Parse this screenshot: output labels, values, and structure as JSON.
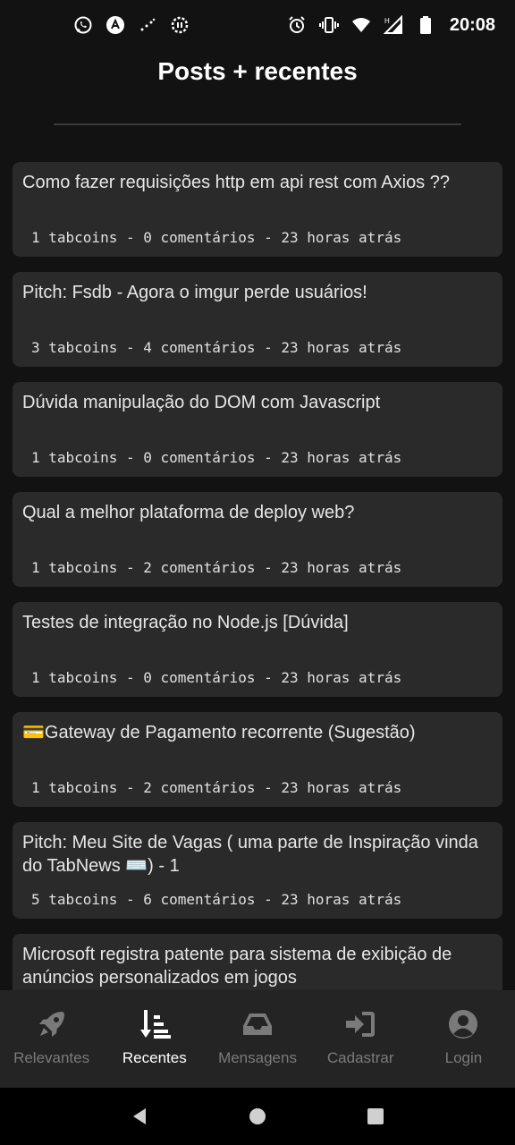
{
  "status_bar": {
    "time": "20:08",
    "left_icons": [
      "whatsapp-icon",
      "app-icon",
      "signal-dots-icon",
      "notification-icon"
    ],
    "right_icons": [
      "alarm-icon",
      "vibrate-icon",
      "wifi-icon",
      "cell-signal-icon",
      "battery-icon"
    ]
  },
  "header": {
    "title": "Posts + recentes"
  },
  "posts": [
    {
      "title": "Como fazer requisições http em api rest com Axios ??",
      "meta": "1 tabcoins - 0 comentários - 23 horas atrás"
    },
    {
      "title": "Pitch: Fsdb - Agora o imgur perde usuários!",
      "meta": "3 tabcoins - 4 comentários - 23 horas atrás"
    },
    {
      "title": "Dúvida manipulação do DOM com Javascript",
      "meta": "1 tabcoins - 0 comentários - 23 horas atrás"
    },
    {
      "title": "Qual a melhor plataforma de deploy web?",
      "meta": "1 tabcoins - 2 comentários - 23 horas atrás"
    },
    {
      "title": "Testes de integração no Node.js [Dúvida]",
      "meta": "1 tabcoins - 0 comentários - 23 horas atrás"
    },
    {
      "title": "💳Gateway de Pagamento recorrente (Sugestão)",
      "meta": "1 tabcoins - 2 comentários - 23 horas atrás"
    },
    {
      "title": "Pitch: Meu Site de Vagas ( uma parte de Inspiração vinda do TabNews ⌨️) - 1",
      "meta": "5 tabcoins - 6 comentários - 23 horas atrás"
    },
    {
      "title": "Microsoft registra patente para sistema de exibição de anúncios personalizados em jogos",
      "meta": ""
    }
  ],
  "bottom_nav": {
    "items": [
      {
        "label": "Relevantes",
        "icon": "rocket-icon"
      },
      {
        "label": "Recentes",
        "icon": "sort-recent-icon"
      },
      {
        "label": "Mensagens",
        "icon": "inbox-icon"
      },
      {
        "label": "Cadastrar",
        "icon": "sign-in-icon"
      },
      {
        "label": "Login",
        "icon": "user-circle-icon"
      }
    ],
    "active_index": 1
  },
  "colors": {
    "background": "#121212",
    "card": "#2a2a2a",
    "nav_bg": "#242424",
    "active": "#ffffff",
    "inactive": "#7a7a7a"
  }
}
